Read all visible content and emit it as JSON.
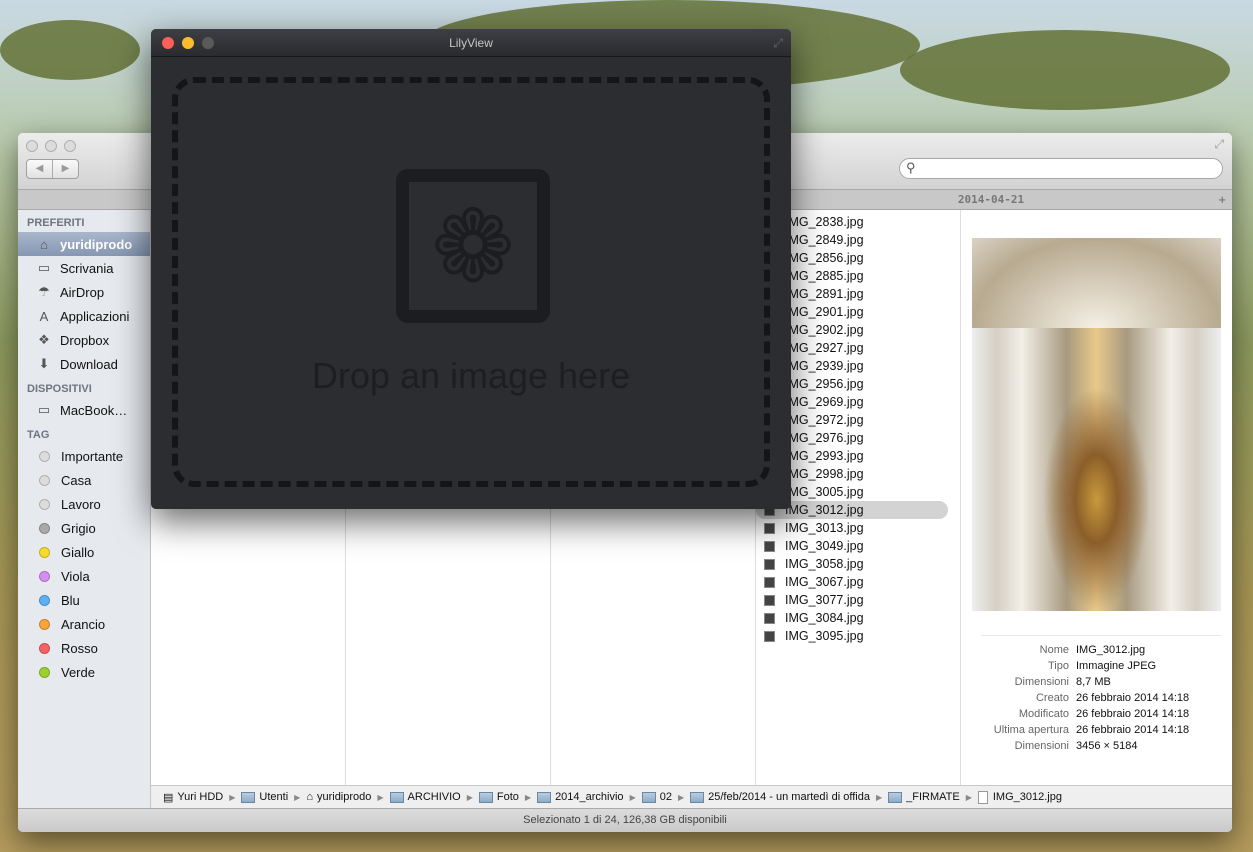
{
  "finder": {
    "tab": "2014-04-21",
    "sidebar": {
      "favorites_header": "PREFERITI",
      "favorites": [
        {
          "label": "yuridiprodo",
          "icon": "home-icon"
        },
        {
          "label": "Scrivania",
          "icon": "desktop-icon"
        },
        {
          "label": "AirDrop",
          "icon": "airdrop-icon"
        },
        {
          "label": "Applicazioni",
          "icon": "applications-icon"
        },
        {
          "label": "Dropbox",
          "icon": "dropbox-icon"
        },
        {
          "label": "Download",
          "icon": "download-icon"
        }
      ],
      "devices_header": "DISPOSITIVI",
      "devices": [
        {
          "label": "MacBook…",
          "icon": "laptop-icon"
        }
      ],
      "tags_header": "TAG",
      "tags": [
        {
          "label": "Importante",
          "color": "#dcdcdc"
        },
        {
          "label": "Casa",
          "color": "#dcdcdc"
        },
        {
          "label": "Lavoro",
          "color": "#dcdcdc"
        },
        {
          "label": "Grigio",
          "color": "#a9a9a9"
        },
        {
          "label": "Giallo",
          "color": "#f5dc2a"
        },
        {
          "label": "Viola",
          "color": "#d58ef0"
        },
        {
          "label": "Blu",
          "color": "#5eb0f5"
        },
        {
          "label": "Arancio",
          "color": "#f9a33a"
        },
        {
          "label": "Rosso",
          "color": "#f56262"
        },
        {
          "label": "Verde",
          "color": "#9bd12e"
        }
      ]
    },
    "files": [
      "IMG_2838.jpg",
      "IMG_2849.jpg",
      "IMG_2856.jpg",
      "IMG_2885.jpg",
      "IMG_2891.jpg",
      "IMG_2901.jpg",
      "IMG_2902.jpg",
      "IMG_2927.jpg",
      "IMG_2939.jpg",
      "IMG_2956.jpg",
      "IMG_2969.jpg",
      "IMG_2972.jpg",
      "IMG_2976.jpg",
      "IMG_2993.jpg",
      "IMG_2998.jpg",
      "IMG_3005.jpg",
      "IMG_3012.jpg",
      "IMG_3013.jpg",
      "IMG_3049.jpg",
      "IMG_3058.jpg",
      "IMG_3067.jpg",
      "IMG_3077.jpg",
      "IMG_3084.jpg",
      "IMG_3095.jpg"
    ],
    "selected_file": "IMG_3012.jpg",
    "info": [
      {
        "k": "Nome",
        "v": "IMG_3012.jpg"
      },
      {
        "k": "Tipo",
        "v": "Immagine JPEG"
      },
      {
        "k": "Dimensioni",
        "v": "8,7 MB"
      },
      {
        "k": "Creato",
        "v": "26 febbraio 2014 14:18"
      },
      {
        "k": "Modificato",
        "v": "26 febbraio 2014 14:18"
      },
      {
        "k": "Ultima apertura",
        "v": "26 febbraio 2014 14:18"
      },
      {
        "k": "Dimensioni",
        "v": "3456 × 5184"
      }
    ],
    "path": [
      "Yuri HDD",
      "Utenti",
      "yuridiprodo",
      "ARCHIVIO",
      "Foto",
      "2014_archivio",
      "02",
      "25/feb/2014 - un martedì di offida",
      "_FIRMATE",
      "IMG_3012.jpg"
    ],
    "status": "Selezionato 1 di 24, 126,38 GB disponibili"
  },
  "lilyview": {
    "title": "LilyView",
    "drop_text": "Drop an image here"
  }
}
